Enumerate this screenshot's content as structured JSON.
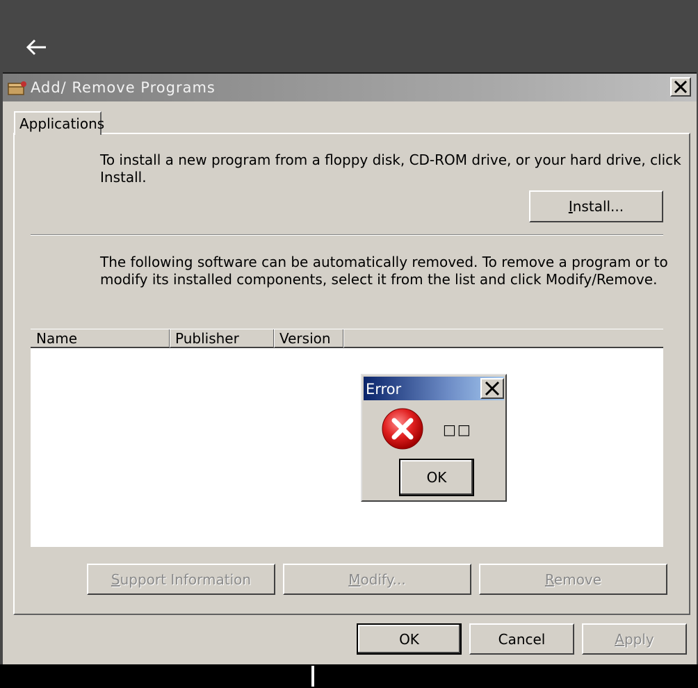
{
  "window": {
    "title": "Add/ Remove Programs",
    "tabs": [
      {
        "label": "Applications"
      }
    ]
  },
  "install_section": {
    "text_line1": "To install a new program from a floppy disk, CD-ROM drive, or your hard drive, click",
    "text_line2": "Install.",
    "install_button": "Install..."
  },
  "remove_section": {
    "text_line1": "The following software can be automatically removed. To remove a program or to",
    "text_line2": "modify its installed components, select it from the list and click Modify/Remove."
  },
  "program_list": {
    "columns": [
      "Name",
      "Publisher",
      "Version"
    ],
    "rows": []
  },
  "action_buttons": {
    "support": "Support Information",
    "modify": "Modify...",
    "remove": "Remove"
  },
  "dialog_buttons": {
    "ok": "OK",
    "cancel": "Cancel",
    "apply": "Apply"
  },
  "error_dialog": {
    "title": "Error",
    "message": "□□",
    "ok_button": "OK"
  },
  "colors": {
    "window_bg": "#d4d0c8",
    "desktop_bg": "#474747",
    "error_icon": "#e02020"
  },
  "icons": {
    "back": "arrow-left-icon",
    "app": "package-icon",
    "close": "close-icon",
    "error": "error-icon"
  }
}
